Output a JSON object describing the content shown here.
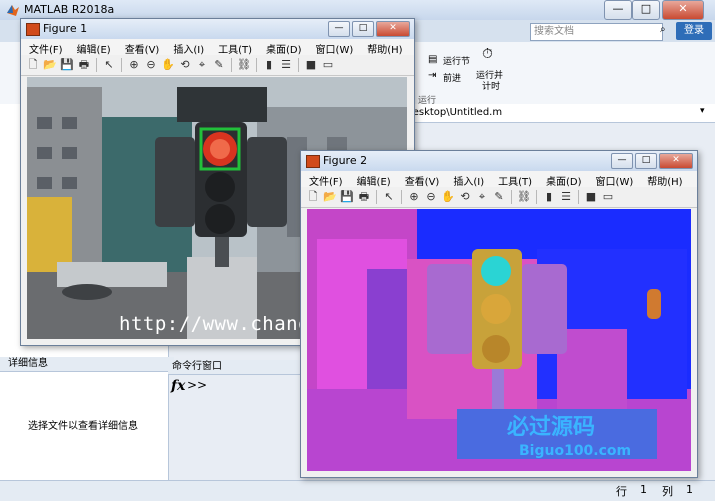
{
  "app": {
    "title": "MATLAB R2018a",
    "window_buttons": [
      "—",
      "□",
      "✕"
    ],
    "search_placeholder": "搜索文档",
    "login": "登录",
    "ribbon": {
      "run_section": "运行节",
      "advance": "前进",
      "run_and_time_1": "运行并",
      "run_and_time_2": "计时",
      "group_run": "运行"
    },
    "path_text": "Desktop\\Untitled.m",
    "detail_header": "详细信息",
    "detail_hint": "选择文件以查看详细信息",
    "command_window_header": "命令行窗口",
    "fx": "fx",
    "prompt": ">>",
    "status": {
      "row_label": "行",
      "row_value": "1",
      "col_label": "列",
      "col_value": "1"
    }
  },
  "figure1": {
    "title": "Figure 1",
    "menus": [
      "文件(F)",
      "编辑(E)",
      "查看(V)",
      "插入(I)",
      "工具(T)",
      "桌面(D)",
      "窗口(W)",
      "帮助(H)"
    ],
    "watermark": "http://www.chang"
  },
  "figure2": {
    "title": "Figure 2",
    "menus": [
      "文件(F)",
      "编辑(E)",
      "查看(V)",
      "插入(I)",
      "工具(T)",
      "桌面(D)",
      "窗口(W)",
      "帮助(H)"
    ],
    "watermark_cn": "必过源码",
    "watermark_en": "Biguo100.com"
  },
  "colors": {
    "detection_box": "#22c03a",
    "hsv_blue": "#1a2cff",
    "hsv_magenta": "#e050e0"
  },
  "icons": {
    "toolbar": [
      "new-icon",
      "open-icon",
      "save-icon",
      "print-icon",
      "pointer-icon",
      "zoom-in-icon",
      "zoom-out-icon",
      "pan-icon",
      "rotate-icon",
      "data-cursor-icon",
      "brush-icon",
      "link-icon",
      "colorbar-icon",
      "legend-icon",
      "hide-tools-icon",
      "dock-icon"
    ]
  }
}
